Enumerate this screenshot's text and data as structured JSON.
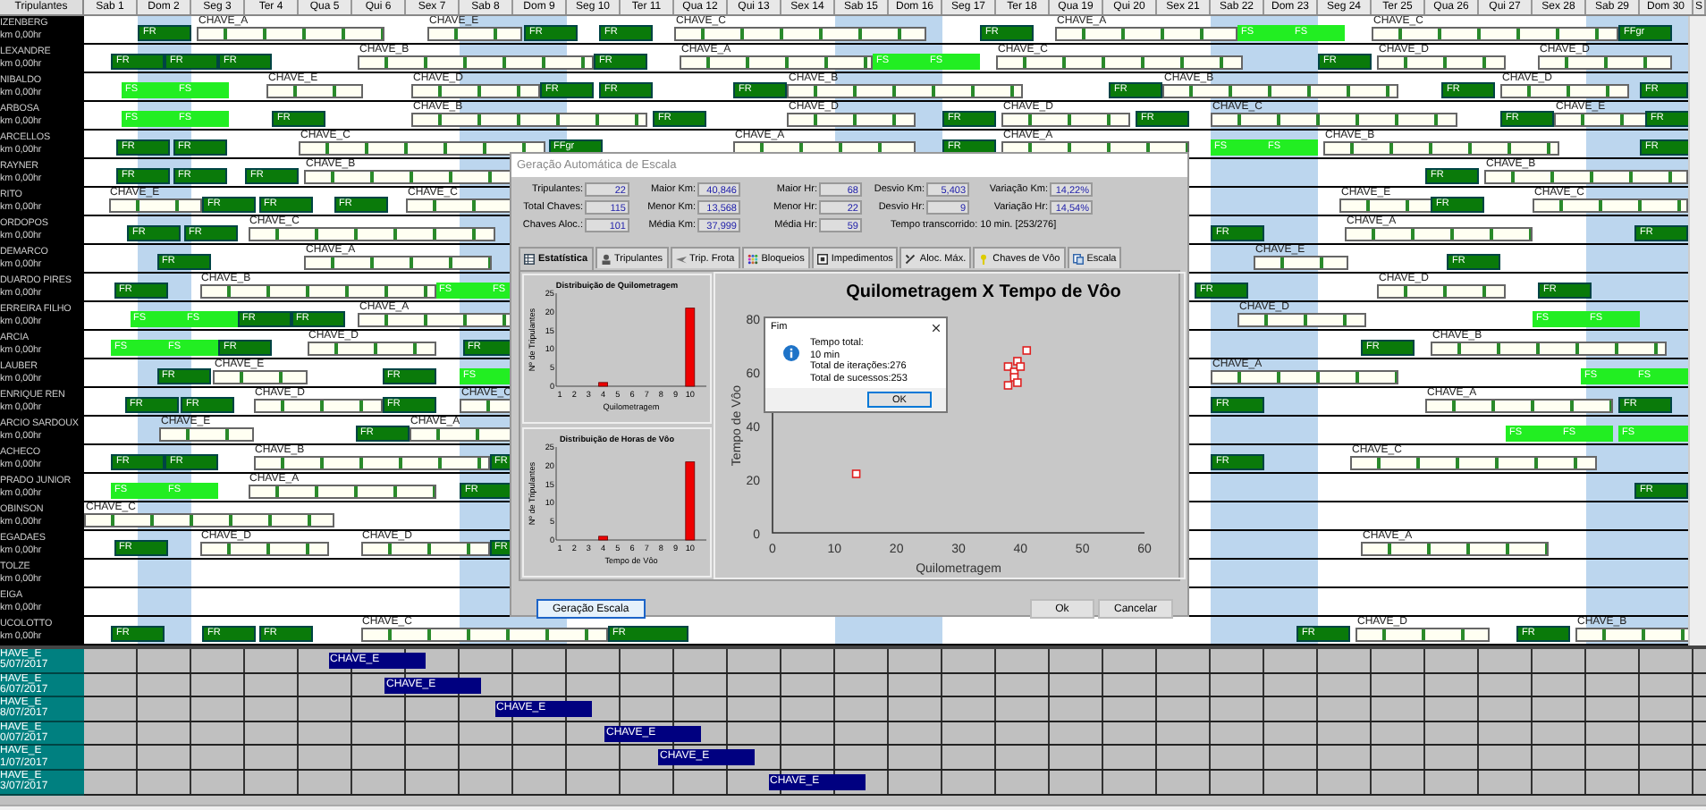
{
  "header": {
    "crew_column": "Tripulantes"
  },
  "days": [
    {
      "label": "Sab 1",
      "shaded": false
    },
    {
      "label": "Dom 2",
      "shaded": true
    },
    {
      "label": "Seg 3",
      "shaded": false
    },
    {
      "label": "Ter 4",
      "shaded": false
    },
    {
      "label": "Qua 5",
      "shaded": false
    },
    {
      "label": "Qui 6",
      "shaded": false
    },
    {
      "label": "Sex 7",
      "shaded": false
    },
    {
      "label": "Sab 8",
      "shaded": true
    },
    {
      "label": "Dom 9",
      "shaded": true
    },
    {
      "label": "Seg 10",
      "shaded": false
    },
    {
      "label": "Ter 11",
      "shaded": false
    },
    {
      "label": "Qua 12",
      "shaded": false
    },
    {
      "label": "Qui 13",
      "shaded": false
    },
    {
      "label": "Sex 14",
      "shaded": false
    },
    {
      "label": "Sab 15",
      "shaded": true
    },
    {
      "label": "Dom 16",
      "shaded": true
    },
    {
      "label": "Seg 17",
      "shaded": false
    },
    {
      "label": "Ter 18",
      "shaded": false
    },
    {
      "label": "Qua 19",
      "shaded": false
    },
    {
      "label": "Qui 20",
      "shaded": false
    },
    {
      "label": "Sex 21",
      "shaded": false
    },
    {
      "label": "Sab 22",
      "shaded": true
    },
    {
      "label": "Dom 23",
      "shaded": true
    },
    {
      "label": "Seg 24",
      "shaded": false
    },
    {
      "label": "Ter 25",
      "shaded": false
    },
    {
      "label": "Qua 26",
      "shaded": false
    },
    {
      "label": "Qui 27",
      "shaded": false
    },
    {
      "label": "Sex 28",
      "shaded": false
    },
    {
      "label": "Sab 29",
      "shaded": true
    },
    {
      "label": "Dom 30",
      "shaded": true
    },
    {
      "label": "S"
    }
  ],
  "crew": [
    {
      "name": "IZENBERG",
      "info": "km 0,00hr",
      "blocks": [
        {
          "kind": "fr",
          "label": "FR"
        },
        {
          "kind": "chave",
          "label": "CHAVE_A"
        },
        {
          "kind": "chave",
          "label": "CHAVE_E"
        },
        {
          "kind": "fr",
          "label": "FR"
        },
        {
          "kind": "fr",
          "label": "FR"
        },
        {
          "kind": "chave",
          "label": "CHAVE_C"
        },
        {
          "kind": "fr",
          "label": "FR"
        },
        {
          "kind": "chave",
          "label": "CHAVE_A"
        },
        {
          "kind": "fs",
          "label": "FS"
        },
        {
          "kind": "fs",
          "label": "FS"
        },
        {
          "kind": "chave",
          "label": "CHAVE_C"
        },
        {
          "kind": "fr",
          "label": "FFgr"
        }
      ]
    },
    {
      "name": "LEXANDRE",
      "info": "km 0,00hr",
      "blocks": [
        {
          "kind": "fr",
          "label": "FR"
        },
        {
          "kind": "fr",
          "label": "FR"
        },
        {
          "kind": "fr",
          "label": "FR"
        },
        {
          "kind": "chave",
          "label": "CHAVE_B"
        },
        {
          "kind": "fr",
          "label": "FR"
        },
        {
          "kind": "chave",
          "label": "CHAVE_A"
        },
        {
          "kind": "fs",
          "label": "FS"
        },
        {
          "kind": "fs",
          "label": "FS"
        },
        {
          "kind": "chave",
          "label": "CHAVE_C"
        },
        {
          "kind": "fr",
          "label": "FR"
        },
        {
          "kind": "chave",
          "label": "CHAVE_D"
        },
        {
          "kind": "chave",
          "label": "CHAVE_D"
        }
      ]
    },
    {
      "name": "NIBALDO",
      "info": "km 0,00hr",
      "blocks": [
        {
          "kind": "fs",
          "label": "FS"
        },
        {
          "kind": "fs",
          "label": "FS"
        },
        {
          "kind": "chave",
          "label": "CHAVE_E"
        },
        {
          "kind": "chave",
          "label": "CHAVE_D"
        },
        {
          "kind": "fr",
          "label": "FR"
        },
        {
          "kind": "fr",
          "label": "FR"
        },
        {
          "kind": "fr",
          "label": "FR"
        },
        {
          "kind": "chave",
          "label": "CHAVE_B"
        },
        {
          "kind": "fr",
          "label": "FR"
        },
        {
          "kind": "chave",
          "label": "CHAVE_B"
        },
        {
          "kind": "fr",
          "label": "FR"
        },
        {
          "kind": "chave",
          "label": "CHAVE_D"
        },
        {
          "kind": "fr",
          "label": "FR"
        }
      ]
    },
    {
      "name": "ARBOSA",
      "info": "km 0,00hr",
      "blocks": [
        {
          "kind": "fs",
          "label": "FS"
        },
        {
          "kind": "fs",
          "label": "FS"
        },
        {
          "kind": "fr",
          "label": "FR"
        },
        {
          "kind": "chave",
          "label": "CHAVE_B"
        },
        {
          "kind": "fr",
          "label": "FR"
        },
        {
          "kind": "chave",
          "label": "CHAVE_D"
        },
        {
          "kind": "fr",
          "label": "FR"
        },
        {
          "kind": "chave",
          "label": "CHAVE_D"
        },
        {
          "kind": "fr",
          "label": "FR"
        },
        {
          "kind": "chave",
          "label": "CHAVE_C"
        },
        {
          "kind": "fr",
          "label": "FR"
        },
        {
          "kind": "chave",
          "label": "CHAVE_E"
        },
        {
          "kind": "fr",
          "label": "FR"
        }
      ]
    },
    {
      "name": "ARCELLOS",
      "info": "km 0,00hr",
      "blocks": [
        {
          "kind": "fr",
          "label": "FR"
        },
        {
          "kind": "fr",
          "label": "FR"
        },
        {
          "kind": "chave",
          "label": "CHAVE_C"
        },
        {
          "kind": "fr",
          "label": "FFgr"
        },
        {
          "kind": "chave",
          "label": "CHAVE_A"
        },
        {
          "kind": "fr",
          "label": "FR"
        },
        {
          "kind": "chave",
          "label": "CHAVE_A"
        },
        {
          "kind": "fs",
          "label": "FS"
        },
        {
          "kind": "fs",
          "label": "FS"
        },
        {
          "kind": "chave",
          "label": "CHAVE_B"
        },
        {
          "kind": "fr",
          "label": "FR"
        }
      ]
    },
    {
      "name": "RAYNER",
      "info": "km 0,00hr",
      "blocks": [
        {
          "kind": "fr",
          "label": "FR"
        },
        {
          "kind": "fr",
          "label": "FR"
        },
        {
          "kind": "fr",
          "label": "FR"
        },
        {
          "kind": "chave",
          "label": "CHAVE_B"
        },
        {
          "kind": "fr",
          "label": "FR"
        },
        {
          "kind": "chave",
          "label": "CHAVE_B"
        }
      ]
    },
    {
      "name": "RITO",
      "info": "km 0,00hr",
      "blocks": [
        {
          "kind": "chave",
          "label": "CHAVE_E"
        },
        {
          "kind": "fr",
          "label": "FR"
        },
        {
          "kind": "fr",
          "label": "FR"
        },
        {
          "kind": "fr",
          "label": "FR"
        },
        {
          "kind": "chave",
          "label": "CHAVE_C"
        },
        {
          "kind": "chave",
          "label": "CHAVE_E"
        },
        {
          "kind": "fr",
          "label": "FR"
        },
        {
          "kind": "chave",
          "label": "CHAVE_C"
        }
      ]
    },
    {
      "name": "ORDOPOS",
      "info": "km 0,00hr",
      "blocks": [
        {
          "kind": "fr",
          "label": "FR"
        },
        {
          "kind": "fr",
          "label": "FR"
        },
        {
          "kind": "chave",
          "label": "CHAVE_C"
        },
        {
          "kind": "fr",
          "label": "FR"
        },
        {
          "kind": "chave",
          "label": "CHAVE_A"
        },
        {
          "kind": "fr",
          "label": "FR"
        }
      ]
    },
    {
      "name": "DEMARCO",
      "info": "km 0,00hr",
      "blocks": [
        {
          "kind": "fr",
          "label": "FR"
        },
        {
          "kind": "chave",
          "label": "CHAVE_A"
        },
        {
          "kind": "chave",
          "label": "CHAVE_E"
        },
        {
          "kind": "fr",
          "label": "FR"
        }
      ]
    },
    {
      "name": "DUARDO PIRES",
      "info": "km 0,00hr",
      "blocks": [
        {
          "kind": "fr",
          "label": "FR"
        },
        {
          "kind": "chave",
          "label": "CHAVE_B"
        },
        {
          "kind": "fs",
          "label": "FS"
        },
        {
          "kind": "fs",
          "label": "FS"
        },
        {
          "kind": "fr",
          "label": "FR"
        },
        {
          "kind": "chave",
          "label": "CHAVE_D"
        },
        {
          "kind": "fr",
          "label": "FR"
        }
      ]
    },
    {
      "name": "ERREIRA FILHO",
      "info": "km 0,00hr",
      "blocks": [
        {
          "kind": "fs",
          "label": "FS"
        },
        {
          "kind": "fs",
          "label": "FS"
        },
        {
          "kind": "fr",
          "label": "FR"
        },
        {
          "kind": "fr",
          "label": "FR"
        },
        {
          "kind": "chave",
          "label": "CHAVE_A"
        },
        {
          "kind": "chave",
          "label": "CHAVE_D"
        },
        {
          "kind": "fs",
          "label": "FS"
        },
        {
          "kind": "fs",
          "label": "FS"
        }
      ]
    },
    {
      "name": "ARCIA",
      "info": "km 0,00hr",
      "blocks": [
        {
          "kind": "fs",
          "label": "FS"
        },
        {
          "kind": "fs",
          "label": "FS"
        },
        {
          "kind": "fr",
          "label": "FR"
        },
        {
          "kind": "chave",
          "label": "CHAVE_D"
        },
        {
          "kind": "fr",
          "label": "FR"
        },
        {
          "kind": "fr",
          "label": "FR"
        },
        {
          "kind": "chave",
          "label": "CHAVE_B"
        }
      ]
    },
    {
      "name": "LAUBER",
      "info": "km 0,00hr",
      "blocks": [
        {
          "kind": "fr",
          "label": "FR"
        },
        {
          "kind": "chave",
          "label": "CHAVE_E"
        },
        {
          "kind": "fr",
          "label": "FR"
        },
        {
          "kind": "fs",
          "label": "FS"
        },
        {
          "kind": "chave",
          "label": "CHAVE_A"
        },
        {
          "kind": "fs",
          "label": "FS"
        },
        {
          "kind": "fs",
          "label": "FS"
        }
      ]
    },
    {
      "name": "ENRIQUE REN",
      "info": "km 0,00hr",
      "blocks": [
        {
          "kind": "fr",
          "label": "FR"
        },
        {
          "kind": "fr",
          "label": "FR"
        },
        {
          "kind": "chave",
          "label": "CHAVE_D"
        },
        {
          "kind": "fr",
          "label": "FR"
        },
        {
          "kind": "chave",
          "label": "CHAVE_C"
        },
        {
          "kind": "fr",
          "label": "FR"
        },
        {
          "kind": "chave",
          "label": "CHAVE_A"
        },
        {
          "kind": "fr",
          "label": "FR"
        }
      ]
    },
    {
      "name": "ARCIO SARDOUX",
      "info": "km 0,00hr",
      "blocks": [
        {
          "kind": "chave",
          "label": "CHAVE_E"
        },
        {
          "kind": "fr",
          "label": "FR"
        },
        {
          "kind": "chave",
          "label": "CHAVE_A"
        },
        {
          "kind": "fs",
          "label": "FS"
        },
        {
          "kind": "fs",
          "label": "FS"
        },
        {
          "kind": "fs",
          "label": "FS"
        }
      ]
    },
    {
      "name": "ACHECO",
      "info": "km 0,00hr",
      "blocks": [
        {
          "kind": "fr",
          "label": "FR"
        },
        {
          "kind": "fr",
          "label": "FR"
        },
        {
          "kind": "chave",
          "label": "CHAVE_B"
        },
        {
          "kind": "fr",
          "label": "FR"
        },
        {
          "kind": "fr",
          "label": "FR"
        },
        {
          "kind": "chave",
          "label": "CHAVE_C"
        }
      ]
    },
    {
      "name": "PRADO JUNIOR",
      "info": "km 0,00hr",
      "blocks": [
        {
          "kind": "fs",
          "label": "FS"
        },
        {
          "kind": "fs",
          "label": "FS"
        },
        {
          "kind": "chave",
          "label": "CHAVE_A"
        },
        {
          "kind": "fr",
          "label": "FR"
        },
        {
          "kind": "fr",
          "label": "FR"
        }
      ]
    },
    {
      "name": "OBINSON",
      "info": "km 0,00hr",
      "blocks": [
        {
          "kind": "chave",
          "label": "CHAVE_C"
        }
      ]
    },
    {
      "name": "EGADAES",
      "info": "km 0,00hr",
      "blocks": [
        {
          "kind": "fr",
          "label": "FR"
        },
        {
          "kind": "chave",
          "label": "CHAVE_D"
        },
        {
          "kind": "chave",
          "label": "CHAVE_D"
        },
        {
          "kind": "fr",
          "label": "FR"
        },
        {
          "kind": "chave",
          "label": "CHAVE_A"
        }
      ]
    },
    {
      "name": "TOLZE",
      "info": "km 0,00hr"
    },
    {
      "name": "EIGA",
      "info": "km 0,00hr"
    },
    {
      "name": "UCOLOTTO",
      "info": "km 0,00hr",
      "blocks": [
        {
          "kind": "fr",
          "label": "FR"
        },
        {
          "kind": "fr",
          "label": "FR"
        },
        {
          "kind": "fr",
          "label": "FR"
        },
        {
          "kind": "chave",
          "label": "CHAVE_C"
        },
        {
          "kind": "fr",
          "label": "FR"
        },
        {
          "kind": "fr",
          "label": "FR"
        },
        {
          "kind": "chave",
          "label": "CHAVE_D"
        },
        {
          "kind": "fr",
          "label": "FR"
        },
        {
          "kind": "chave",
          "label": "CHAVE_B"
        }
      ]
    }
  ],
  "keys": [
    {
      "name": "HAVE_E",
      "date": "5/07/2017",
      "bar": "CHAVE_E"
    },
    {
      "name": "HAVE_E",
      "date": "6/07/2017",
      "bar": "CHAVE_E"
    },
    {
      "name": "HAVE_E",
      "date": "8/07/2017",
      "bar": "CHAVE_E"
    },
    {
      "name": "HAVE_E",
      "date": "0/07/2017",
      "bar": "CHAVE_E"
    },
    {
      "name": "HAVE_E",
      "date": "1/07/2017",
      "bar": "CHAVE_E"
    },
    {
      "name": "HAVE_E",
      "date": "3/07/2017",
      "bar": "CHAVE_E"
    }
  ],
  "dialog": {
    "title": "Geração Automática de Escala",
    "stats": [
      [
        {
          "label": "Tripulantes:",
          "value": "22"
        },
        {
          "label": "Maior Km:",
          "value": "40,846"
        },
        {
          "label": "Maior Hr:",
          "value": "68"
        },
        {
          "label": "Desvio Km:",
          "value": "5,403"
        },
        {
          "label": "Variação Km:",
          "value": "14,22%"
        }
      ],
      [
        {
          "label": "Total Chaves:",
          "value": "115"
        },
        {
          "label": "Menor Km:",
          "value": "13,568"
        },
        {
          "label": "Menor Hr:",
          "value": "22"
        },
        {
          "label": "Desvio Hr:",
          "value": "9"
        },
        {
          "label": "Variação Hr:",
          "value": "14,54%"
        }
      ],
      [
        {
          "label": "Chaves Aloc.:",
          "value": "101"
        },
        {
          "label": "Média Km:",
          "value": "37,999"
        },
        {
          "label": "Média Hr:",
          "value": "59"
        }
      ]
    ],
    "elapsed": "Tempo transcorrido: 10 min. [253/276]",
    "tabs": [
      {
        "label": "Estatística",
        "selected": true
      },
      {
        "label": "Tripulantes",
        "selected": false
      },
      {
        "label": "Trip. Frota",
        "selected": false
      },
      {
        "label": "Bloqueios",
        "selected": false
      },
      {
        "label": "Impedimentos",
        "selected": false
      },
      {
        "label": "Aloc. Máx.",
        "selected": false
      },
      {
        "label": "Chaves de Vôo",
        "selected": false
      },
      {
        "label": "Escala",
        "selected": false
      }
    ],
    "small_charts": [
      {
        "chart_data": {
          "type": "bar",
          "title": "Distribuição de Quilometragem",
          "xlabel": "Quilometragem",
          "ylabel": "Nº de Tripulantes",
          "categories": [
            "1",
            "2",
            "3",
            "4",
            "5",
            "6",
            "7",
            "8",
            "9",
            "10"
          ],
          "values": [
            0,
            0,
            0,
            1,
            0,
            0,
            0,
            0,
            0,
            21
          ],
          "ylim": [
            0,
            25
          ],
          "yticks": [
            0,
            5,
            10,
            15,
            20,
            25
          ]
        }
      },
      {
        "chart_data": {
          "type": "bar",
          "title": "Distribuição de Horas de Vôo",
          "xlabel": "Tempo de Vôo",
          "ylabel": "Nº de Tripulantes",
          "categories": [
            "1",
            "2",
            "3",
            "4",
            "5",
            "6",
            "7",
            "8",
            "9",
            "10"
          ],
          "values": [
            0,
            0,
            0,
            1,
            0,
            0,
            0,
            0,
            0,
            21
          ],
          "ylim": [
            0,
            25
          ],
          "yticks": [
            0,
            5,
            10,
            15,
            20,
            25
          ]
        }
      }
    ],
    "scatter": {
      "chart_data": {
        "type": "scatter",
        "title": "Quilometragem X Tempo de Vôo",
        "xlabel": "Quilometragem",
        "ylabel": "Tempo de Vôo",
        "x": [
          13.5,
          38,
          38,
          39,
          39,
          39.5,
          39.5,
          40,
          41
        ],
        "series": [
          {
            "color": "#e02020",
            "values": [
              22,
              55,
              62,
              60,
              58,
              64,
              56,
              62,
              68
            ]
          }
        ],
        "xlim": [
          0,
          60
        ],
        "ylim": [
          0,
          80
        ],
        "xticks": [
          0,
          10,
          20,
          30,
          40,
          50,
          60
        ],
        "yticks": [
          0,
          20,
          40,
          60,
          80
        ]
      }
    },
    "buttons": {
      "generate": "Geração Escala",
      "ok": "Ok",
      "cancel": "Cancelar"
    }
  },
  "message": {
    "title": "Fim",
    "lines": [
      "Tempo total:",
      "10 min",
      "Total de iterações:276",
      "Total de sucessos:253"
    ],
    "button": "OK"
  }
}
